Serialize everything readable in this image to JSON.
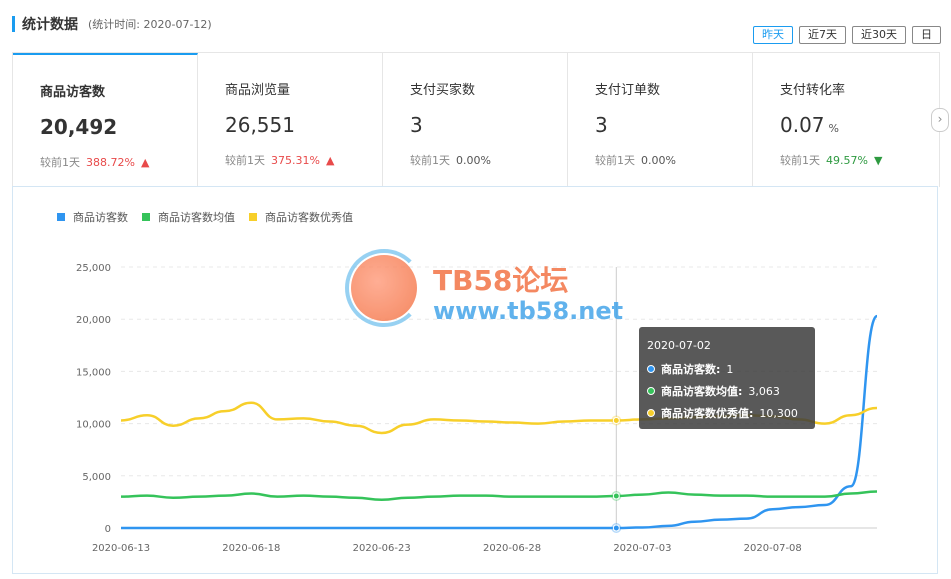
{
  "header": {
    "title": "统计数据",
    "subtitle": "(统计时间: 2020-07-12)"
  },
  "range_buttons": [
    {
      "label": "昨天",
      "active": true
    },
    {
      "label": "近7天",
      "active": false
    },
    {
      "label": "近30天",
      "active": false
    },
    {
      "label": "日",
      "active": false
    }
  ],
  "metrics": [
    {
      "label": "商品访客数",
      "value": "20,492",
      "unit": "",
      "compare_label": "较前1天",
      "delta": "388.72%",
      "trend": "up"
    },
    {
      "label": "商品浏览量",
      "value": "26,551",
      "unit": "",
      "compare_label": "较前1天",
      "delta": "375.31%",
      "trend": "up"
    },
    {
      "label": "支付买家数",
      "value": "3",
      "unit": "",
      "compare_label": "较前1天",
      "delta": "0.00%",
      "trend": "flat"
    },
    {
      "label": "支付订单数",
      "value": "3",
      "unit": "",
      "compare_label": "较前1天",
      "delta": "0.00%",
      "trend": "flat"
    },
    {
      "label": "支付转化率",
      "value": "0.07",
      "unit": "%",
      "compare_label": "较前1天",
      "delta": "49.57%",
      "trend": "down"
    }
  ],
  "next_icon": "chevron-right-icon",
  "watermark": {
    "brand": "TB58论坛",
    "url": "www.tb58.net"
  },
  "tooltip": {
    "date": "2020-07-02",
    "rows": [
      {
        "name": "商品访客数:",
        "value": "1",
        "color": "#2f95f0"
      },
      {
        "name": "商品访客数均值:",
        "value": "3,063",
        "color": "#35c35a"
      },
      {
        "name": "商品访客数优秀值:",
        "value": "10,300",
        "color": "#f7cf2a"
      }
    ]
  },
  "chart_data": {
    "type": "line",
    "x": [
      "2020-06-13",
      "2020-06-14",
      "2020-06-15",
      "2020-06-16",
      "2020-06-17",
      "2020-06-18",
      "2020-06-19",
      "2020-06-20",
      "2020-06-21",
      "2020-06-22",
      "2020-06-23",
      "2020-06-24",
      "2020-06-25",
      "2020-06-26",
      "2020-06-27",
      "2020-06-28",
      "2020-06-29",
      "2020-06-30",
      "2020-07-01",
      "2020-07-02",
      "2020-07-03",
      "2020-07-04",
      "2020-07-05",
      "2020-07-06",
      "2020-07-07",
      "2020-07-08",
      "2020-07-09",
      "2020-07-10",
      "2020-07-11",
      "2020-07-12"
    ],
    "x_tick_labels": [
      "2020-06-13",
      "2020-06-18",
      "2020-06-23",
      "2020-06-28",
      "2020-07-03",
      "2020-07-08"
    ],
    "x_tick_indices": [
      0,
      5,
      10,
      15,
      20,
      25
    ],
    "y_ticks": [
      "0",
      "5,000",
      "10,000",
      "15,000",
      "20,000",
      "25,000"
    ],
    "ylim": [
      0,
      25000
    ],
    "grid": true,
    "legend_position": "top-left",
    "series": [
      {
        "name": "商品访客数",
        "color": "#2f95f0",
        "values": [
          0,
          0,
          0,
          0,
          0,
          0,
          0,
          0,
          0,
          0,
          0,
          0,
          0,
          0,
          0,
          0,
          0,
          0,
          0,
          1,
          50,
          200,
          600,
          800,
          900,
          1800,
          2000,
          2200,
          4000,
          20300
        ]
      },
      {
        "name": "商品访客数均值",
        "color": "#35c35a",
        "values": [
          3000,
          3100,
          2900,
          3000,
          3100,
          3300,
          3000,
          3100,
          3000,
          2900,
          2700,
          2900,
          3000,
          3100,
          3100,
          3000,
          3000,
          3000,
          3000,
          3063,
          3200,
          3400,
          3200,
          3100,
          3100,
          3000,
          3000,
          3000,
          3300,
          3500
        ]
      },
      {
        "name": "商品访客数优秀值",
        "color": "#f7cf2a",
        "values": [
          10300,
          10800,
          9800,
          10500,
          11200,
          12000,
          10400,
          10500,
          10200,
          9800,
          9100,
          9900,
          10400,
          10300,
          10200,
          10100,
          10000,
          10200,
          10300,
          10300,
          10400,
          10500,
          10600,
          10700,
          10800,
          10700,
          10400,
          10000,
          10800,
          11500
        ]
      }
    ],
    "highlight_index": 19
  }
}
